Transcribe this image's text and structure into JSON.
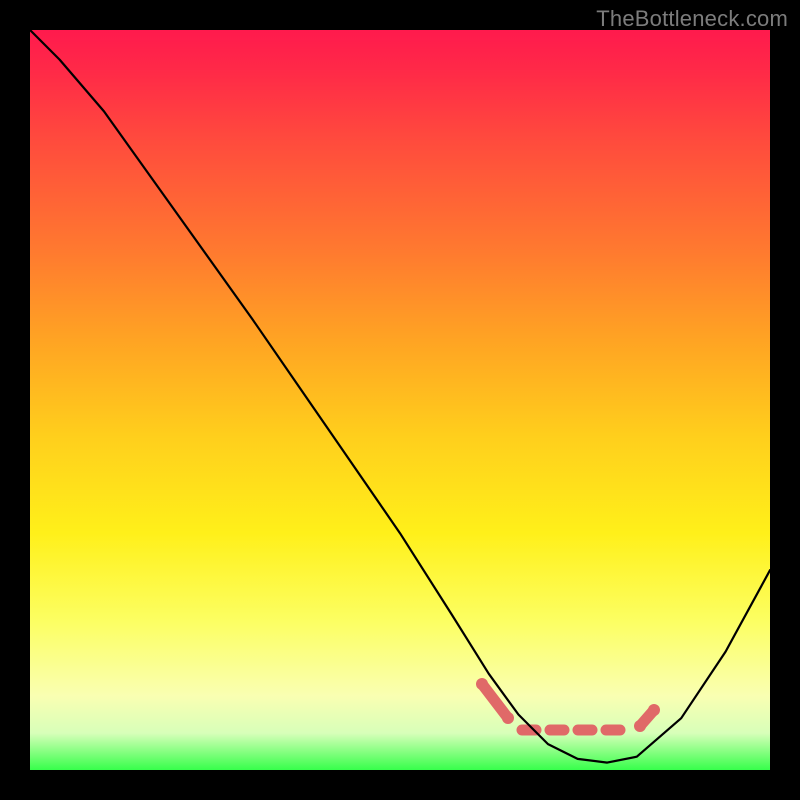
{
  "watermark": "TheBottleneck.com",
  "colors": {
    "background": "#000000",
    "curve": "#000000",
    "marker": "#e06968",
    "gradient_top": "#ff1a4d",
    "gradient_bottom": "#37ff4b"
  },
  "chart_data": {
    "type": "line",
    "title": "",
    "xlabel": "",
    "ylabel": "",
    "xlim": [
      0,
      100
    ],
    "ylim": [
      0,
      100
    ],
    "series": [
      {
        "name": "bottleneck-curve",
        "x": [
          0,
          4,
          10,
          20,
          30,
          40,
          50,
          57,
          62,
          66,
          70,
          74,
          78,
          82,
          88,
          94,
          100
        ],
        "values": [
          100,
          96,
          89,
          75,
          61,
          46.5,
          32,
          21,
          13,
          7.5,
          3.5,
          1.5,
          1,
          1.8,
          7,
          16,
          27
        ]
      }
    ],
    "annotations": [
      {
        "name": "highlight-range",
        "x_start": 62,
        "x_end": 82,
        "style": "red-band-near-minimum"
      }
    ]
  }
}
